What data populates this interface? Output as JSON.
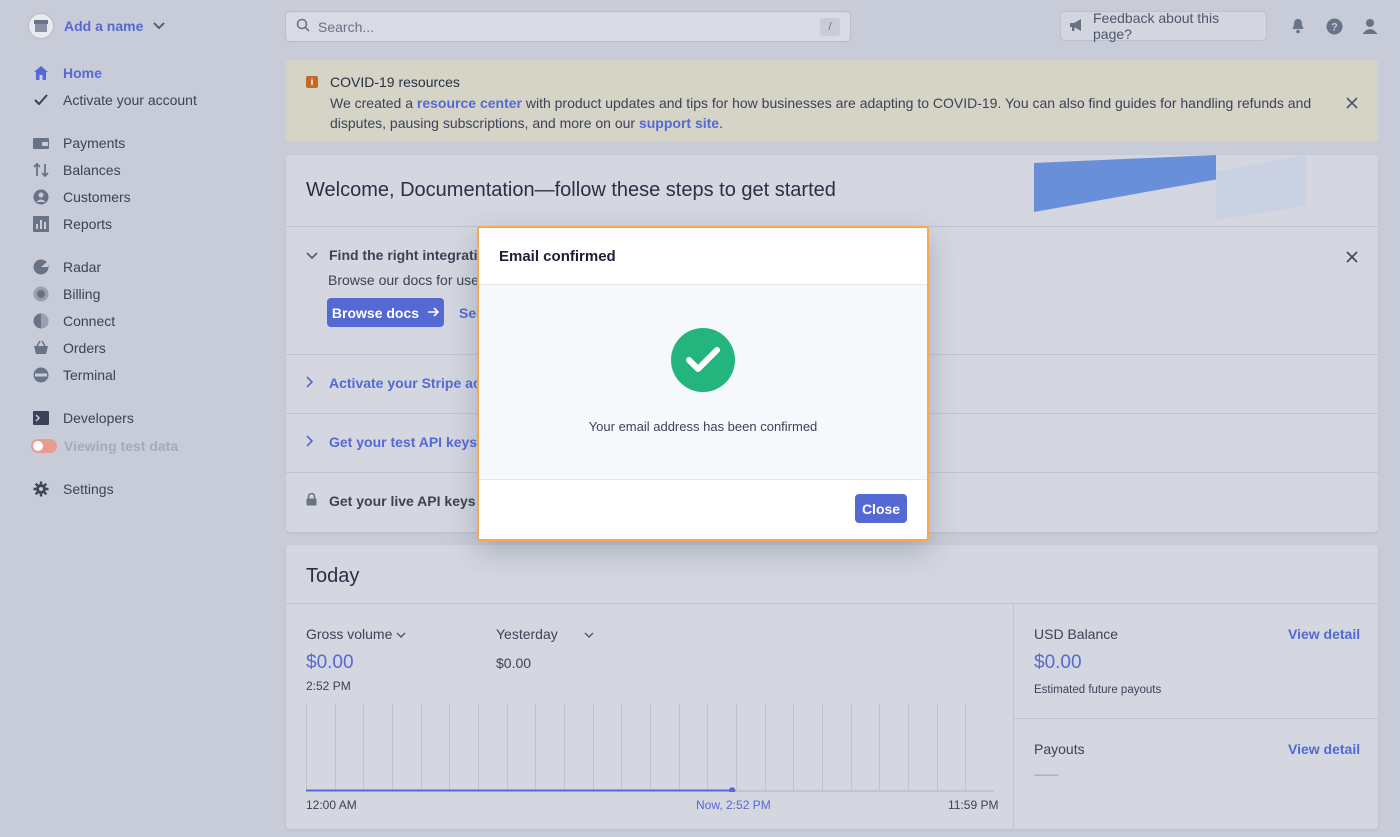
{
  "account": {
    "name": "Add a name"
  },
  "sidebar": {
    "items": [
      {
        "label": "Home",
        "icon": "home-icon"
      },
      {
        "label": "Activate your account",
        "icon": "check-icon"
      },
      {
        "label": "Payments",
        "icon": "payments-icon"
      },
      {
        "label": "Balances",
        "icon": "balances-icon"
      },
      {
        "label": "Customers",
        "icon": "customers-icon"
      },
      {
        "label": "Reports",
        "icon": "reports-icon"
      },
      {
        "label": "Radar",
        "icon": "radar-icon"
      },
      {
        "label": "Billing",
        "icon": "billing-icon"
      },
      {
        "label": "Connect",
        "icon": "connect-icon"
      },
      {
        "label": "Orders",
        "icon": "orders-icon"
      },
      {
        "label": "Terminal",
        "icon": "terminal-icon"
      },
      {
        "label": "Developers",
        "icon": "developers-icon"
      },
      {
        "label": "Viewing test data",
        "icon": "toggle-icon"
      },
      {
        "label": "Settings",
        "icon": "gear-icon"
      }
    ]
  },
  "search": {
    "placeholder": "Search...",
    "shortcut": "/"
  },
  "topbar": {
    "feedback_label": "Feedback about this page?"
  },
  "banner": {
    "title": "COVID-19 resources",
    "text_1": "We created a ",
    "link_1": "resource center",
    "text_2": " with product updates and tips for how businesses are adapting to COVID-19. You can also find guides for handling refunds and disputes, pausing subscriptions, and more on our ",
    "link_2": "support site",
    "text_3": "."
  },
  "welcome": {
    "title": "Welcome, Documentation—follow these steps to get started",
    "step1_title": "Find the right integration",
    "step1_desc": "Browse our docs for use",
    "browse_button": "Browse docs",
    "see_link": "See",
    "step2": "Activate your Stripe account",
    "step3": "Get your test API keys",
    "step4": "Get your live API keys"
  },
  "today": {
    "title": "Today",
    "gross_label": "Gross volume",
    "gross_value": "$0.00",
    "gross_time": "2:52 PM",
    "yesterday_label": "Yesterday",
    "yesterday_value": "$0.00",
    "axis_start": "12:00 AM",
    "axis_now": "Now, 2:52 PM",
    "axis_end": "11:59 PM",
    "usd_label": "USD Balance",
    "usd_value": "$0.00",
    "usd_sub": "Estimated future payouts",
    "view_detail": "View detail",
    "payouts_label": "Payouts",
    "payouts_value": "——"
  },
  "modal": {
    "title": "Email confirmed",
    "message": "Your email address has been confirmed",
    "close_button": "Close"
  },
  "colors": {
    "accent": "#5469d4",
    "success": "#24b47e",
    "modal_border": "#f5a94a"
  }
}
